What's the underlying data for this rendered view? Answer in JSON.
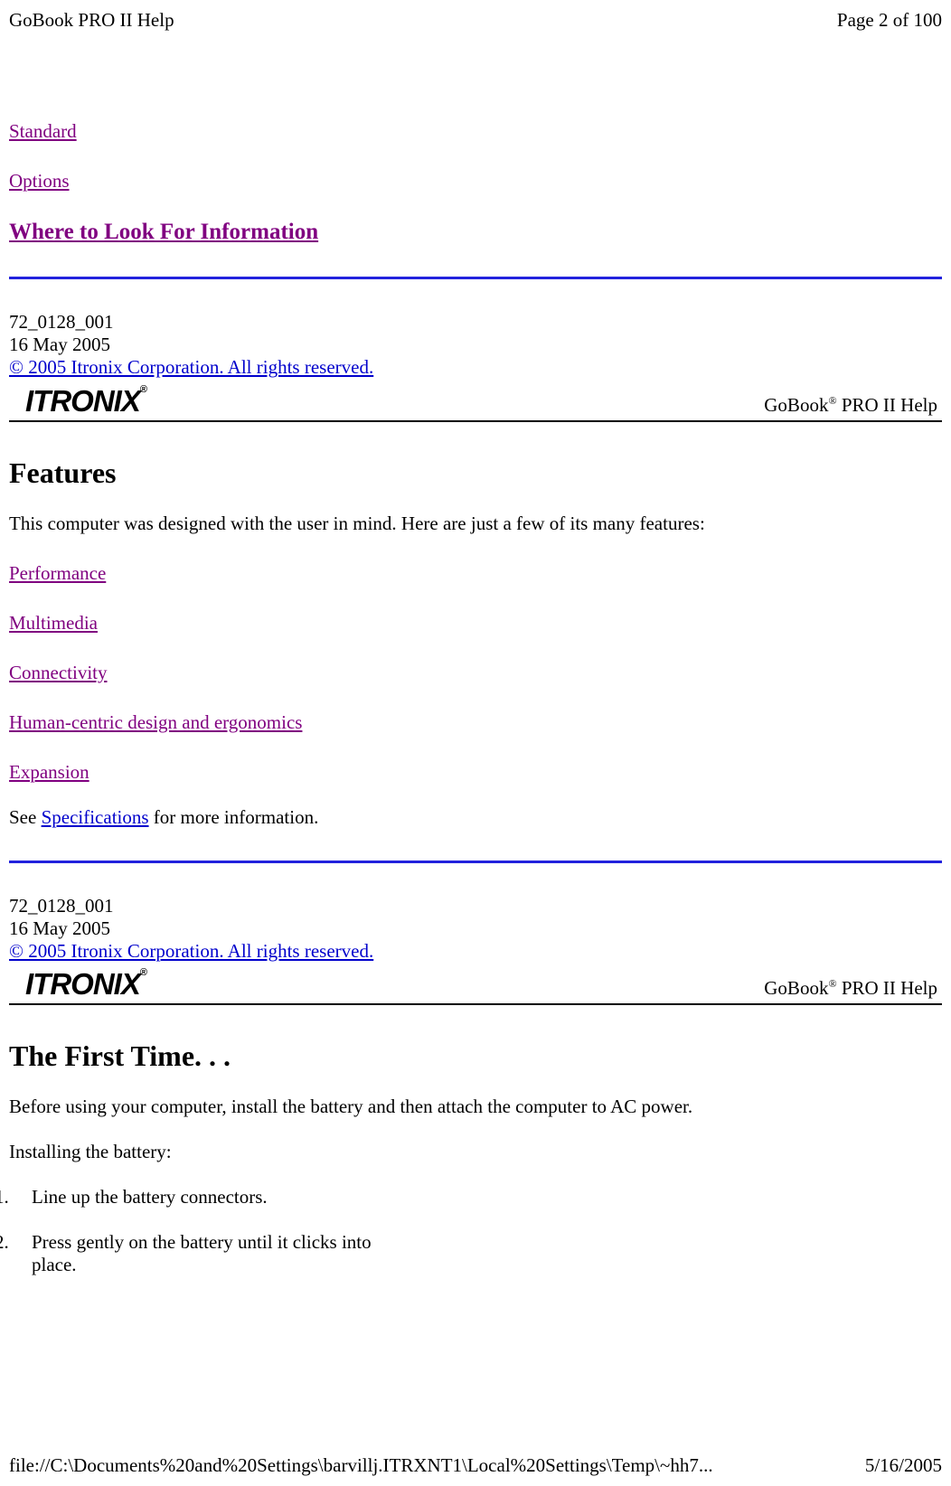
{
  "header": {
    "title": "GoBook PRO II Help",
    "pageInfo": "Page 2 of 100"
  },
  "topLinks": {
    "standard": "Standard",
    "options": "Options",
    "whereToLook": "Where to Look For Information"
  },
  "meta1": {
    "docId": " 72_0128_001",
    "date": "16 May 2005",
    "copyright": "© 2005 Itronix Corporation.  All rights reserved."
  },
  "logo": "ITRONIX",
  "productName1": "GoBook",
  "productSup": "®",
  "productName2": " PRO II Help",
  "section1": {
    "heading": "Features",
    "intro": "This computer was designed with the user in mind. Here are just a few of its many features:",
    "links": {
      "performance": "Performance",
      "multimedia": "Multimedia",
      "connectivity": "Connectivity",
      "humanCentric": "Human-centric design and ergonomics",
      "expansion": "Expansion"
    },
    "seePrefix": "See ",
    "specifications": "Specifications",
    "seeSuffix": " for more information."
  },
  "meta2": {
    "docId": " 72_0128_001",
    "date": "16 May 2005",
    "copyright": "© 2005 Itronix Corporation.  All rights reserved."
  },
  "section2": {
    "heading": "The First Time. . .",
    "intro": "Before using your computer, install the battery and then attach the computer to AC power.",
    "installing": "Installing the battery:",
    "step1": "Line up the battery connectors.",
    "step2": "Press gently on the battery until it clicks into place."
  },
  "footer": {
    "path": "file://C:\\Documents%20and%20Settings\\barvillj.ITRXNT1\\Local%20Settings\\Temp\\~hh7...",
    "date": "5/16/2005"
  }
}
